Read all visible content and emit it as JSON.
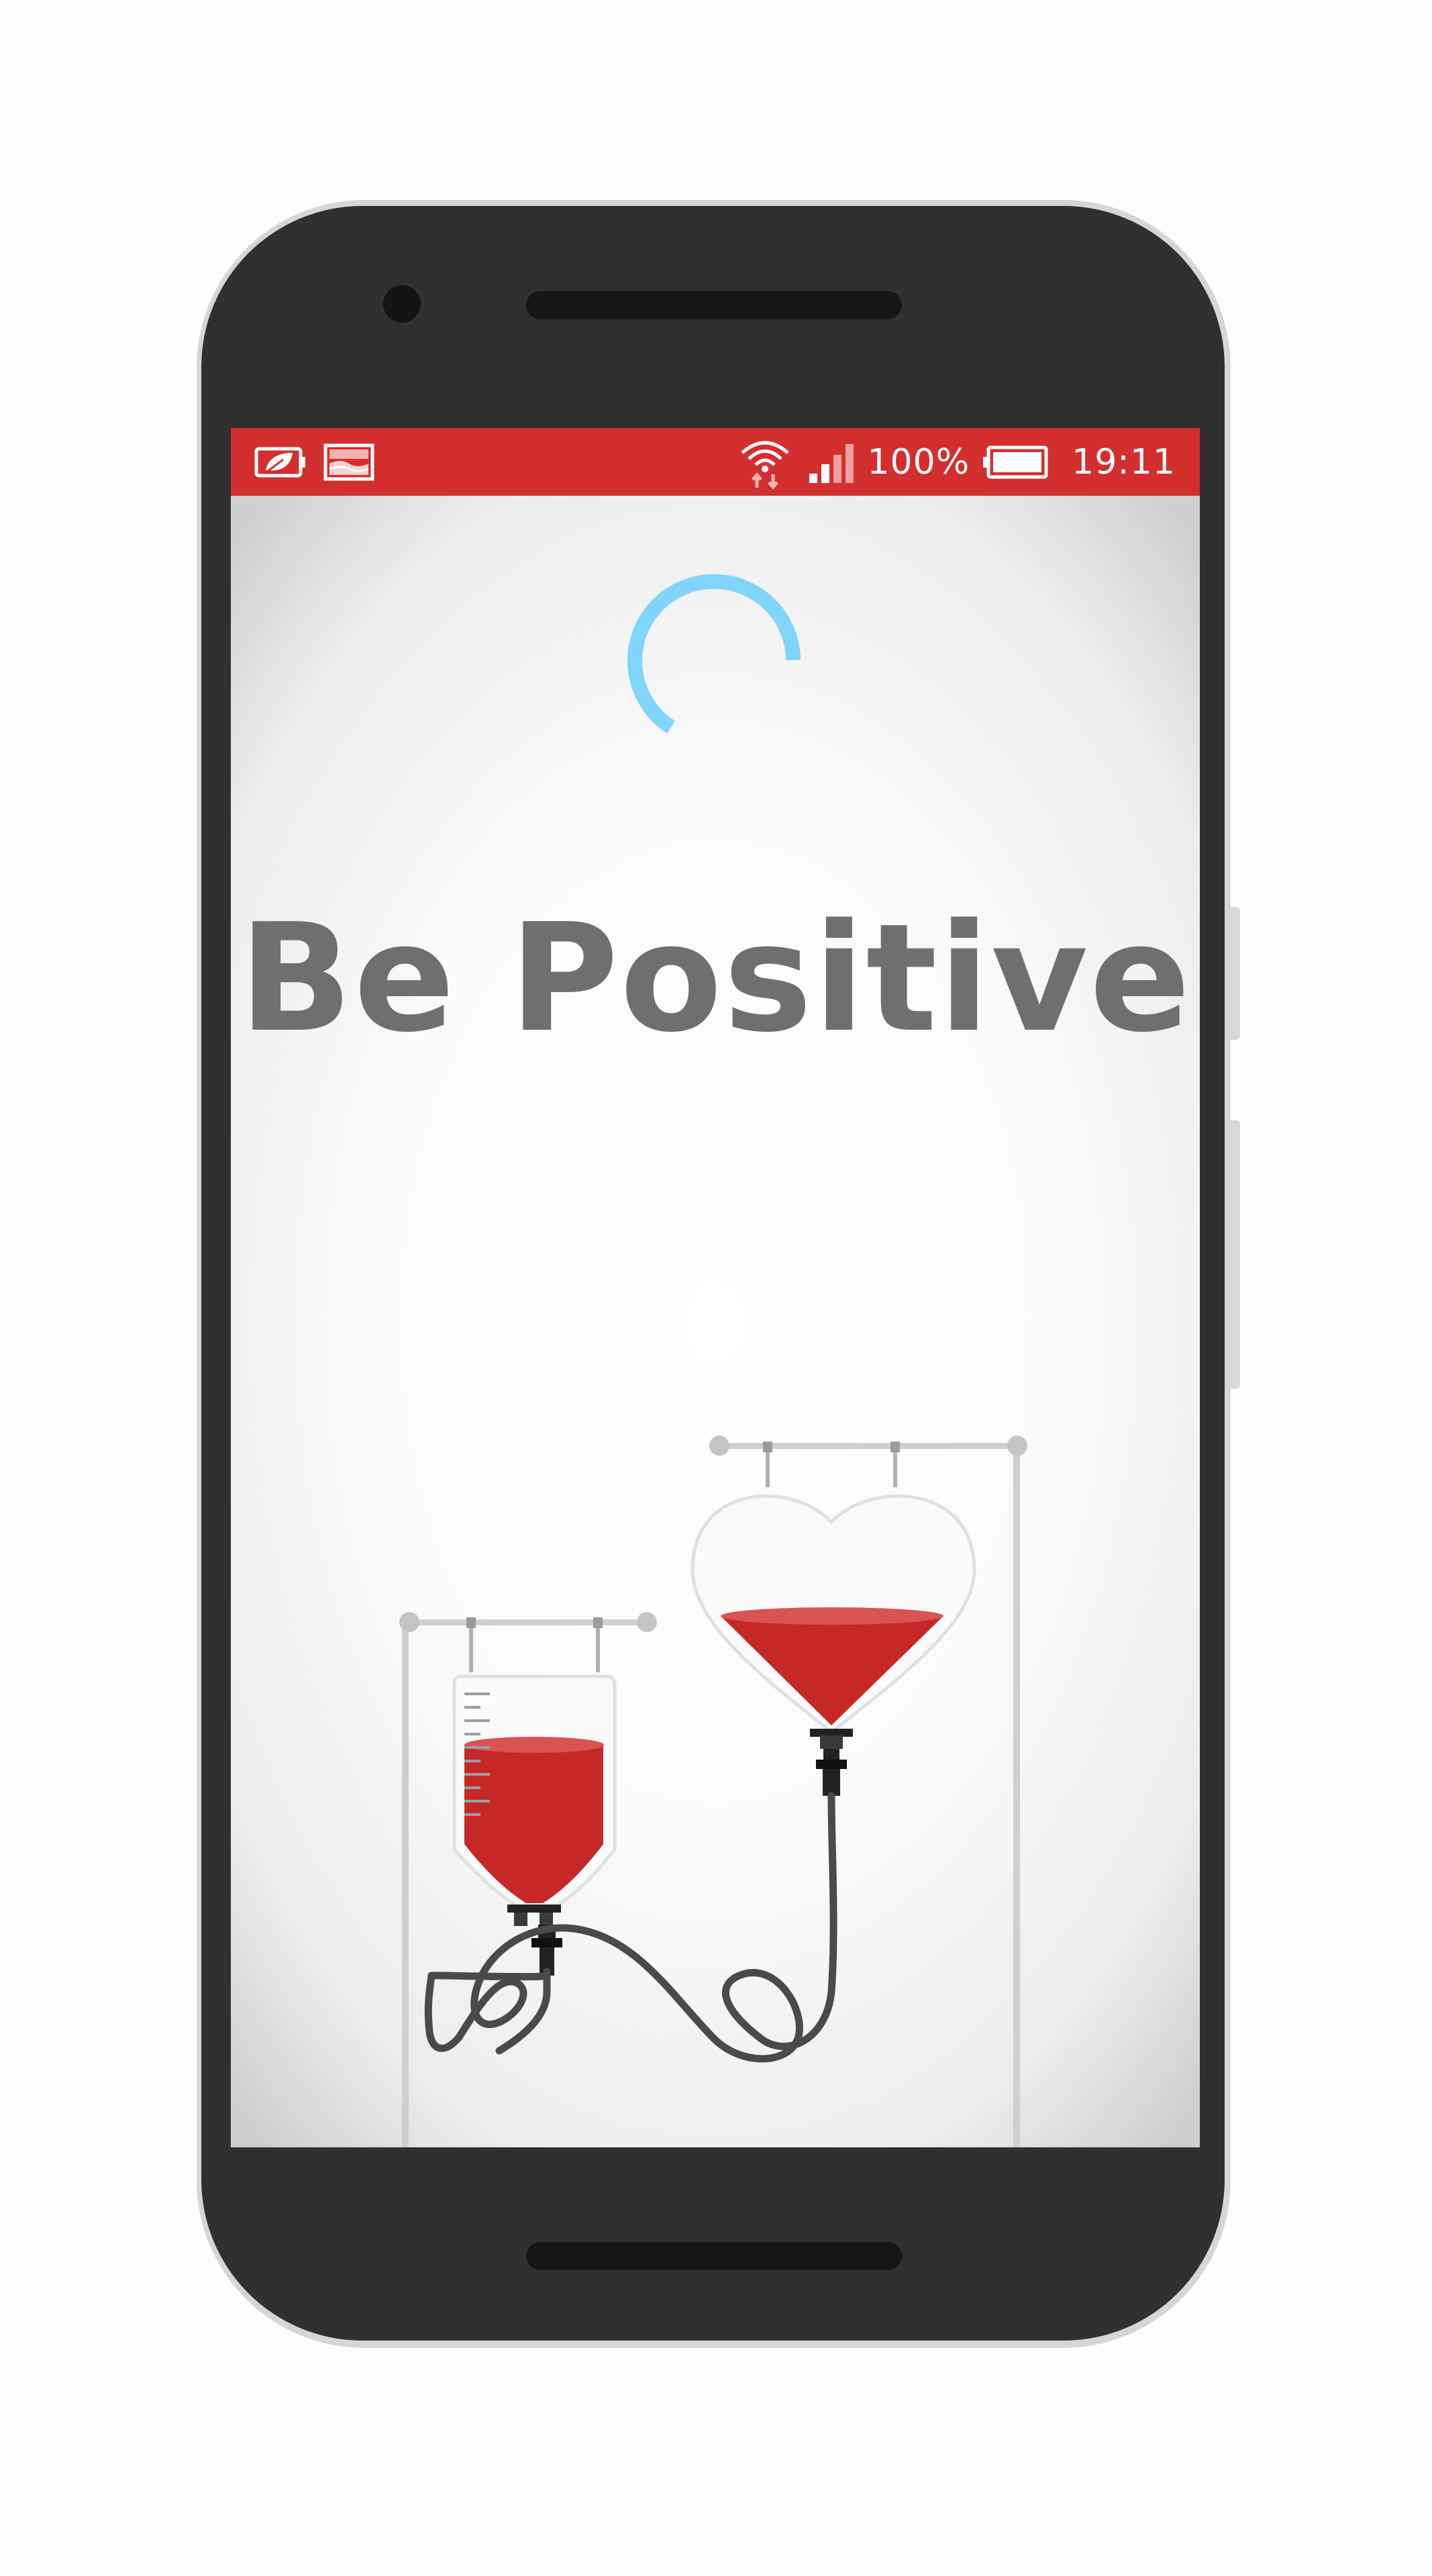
{
  "status_bar": {
    "background_color": "#d32f2f",
    "left_icons": [
      "battery-saver-icon",
      "image-notification-icon"
    ],
    "right_icons": [
      "wifi-data-icon",
      "cellular-signal-icon",
      "battery-icon"
    ],
    "battery_percent": "100%",
    "time": "19:11"
  },
  "app": {
    "title": "Be Positive",
    "loading_indicator": "loading-spinner",
    "illustration": "blood-transfusion-illustration",
    "colors": {
      "title": "#6f6f6f",
      "spinner": "#81d4fa",
      "blood": "#c62828",
      "tube": "#4a4a4a",
      "stand": "#c8c8c8"
    }
  }
}
